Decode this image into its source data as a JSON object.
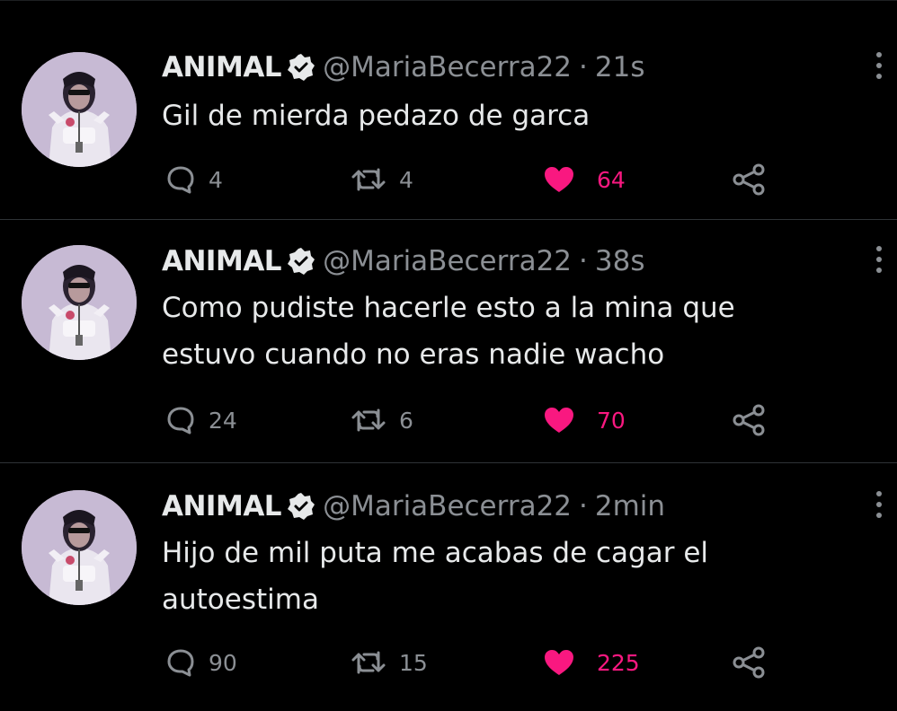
{
  "colors": {
    "background": "#000000",
    "text": "#e7e9ea",
    "muted": "#8b8f94",
    "like": "#f91880",
    "divider": "#2f3336"
  },
  "icons": {
    "reply": "speech-bubble-icon",
    "retweet": "retweet-arrows-icon",
    "like": "heart-filled-icon",
    "share": "share-nodes-icon",
    "more": "vertical-dots-icon",
    "verified": "verified-badge-icon"
  },
  "tweets": [
    {
      "name": "ANIMAL",
      "handle": "@MariaBecerra22",
      "separator": "·",
      "time": "21s",
      "lines": [
        "Gil de mierda pedazo de garca"
      ],
      "replies": "4",
      "retweets": "4",
      "likes": "64"
    },
    {
      "name": "ANIMAL",
      "handle": "@MariaBecerra22",
      "separator": "·",
      "time": "38s",
      "lines": [
        "Como pudiste hacerle esto a la mina que",
        "estuvo cuando no eras nadie wacho"
      ],
      "replies": "24",
      "retweets": "6",
      "likes": "70"
    },
    {
      "name": "ANIMAL",
      "handle": "@MariaBecerra22",
      "separator": "·",
      "time": "2min",
      "lines": [
        "Hijo de mil puta me acabas de cagar el",
        "autoestima"
      ],
      "replies": "90",
      "retweets": "15",
      "likes": "225"
    }
  ]
}
